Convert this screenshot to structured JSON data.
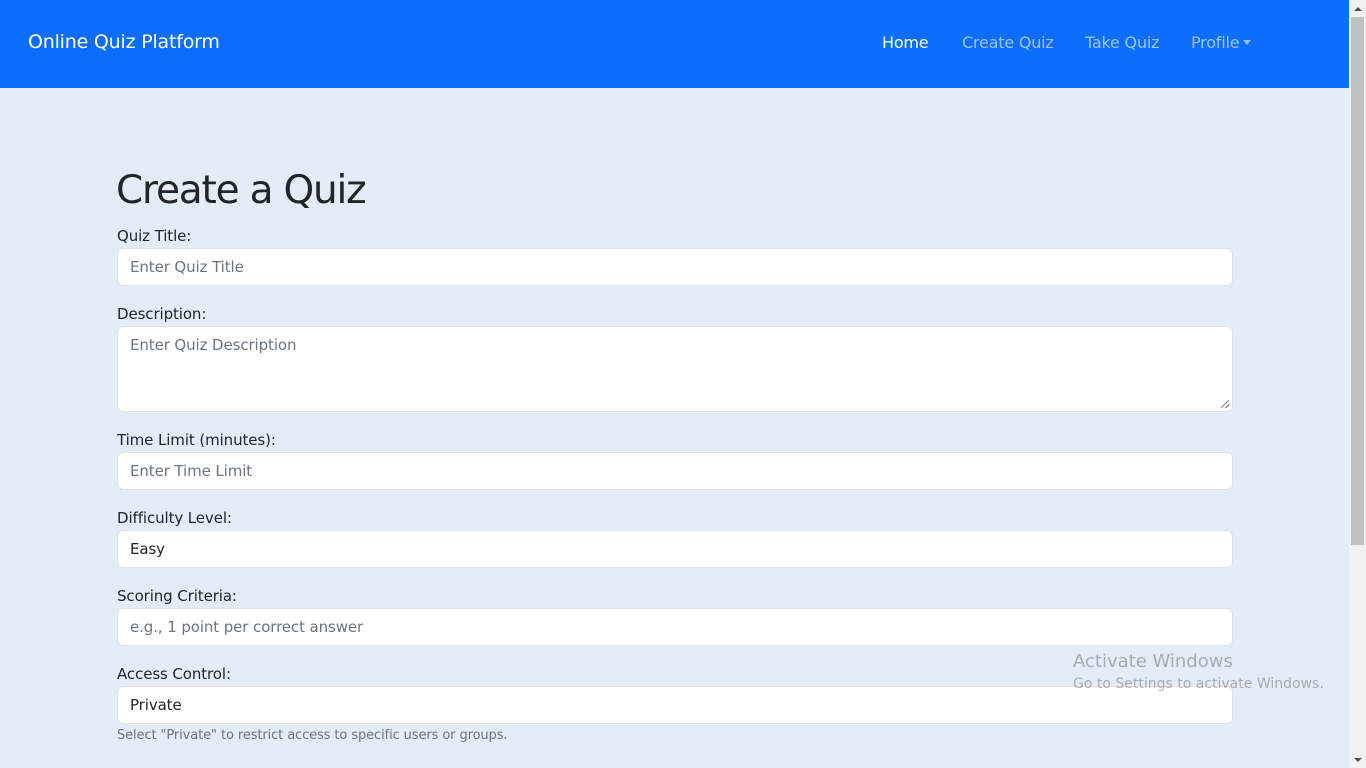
{
  "navbar": {
    "brand": "Online Quiz Platform",
    "links": [
      "Home",
      "Create Quiz",
      "Take Quiz",
      "Profile"
    ],
    "active": "Home"
  },
  "page": {
    "title": "Create a Quiz"
  },
  "form": {
    "quiz_title": {
      "label": "Quiz Title:",
      "placeholder": "Enter Quiz Title"
    },
    "description": {
      "label": "Description:",
      "placeholder": "Enter Quiz Description"
    },
    "time_limit": {
      "label": "Time Limit (minutes):",
      "placeholder": "Enter Time Limit"
    },
    "difficulty": {
      "label": "Difficulty Level:",
      "value": "Easy"
    },
    "scoring": {
      "label": "Scoring Criteria:",
      "placeholder": "e.g., 1 point per correct answer"
    },
    "access": {
      "label": "Access Control:",
      "value": "Private",
      "help": "Select \"Private\" to restrict access to specific users or groups."
    }
  },
  "watermark": {
    "line1": "Activate Windows",
    "line2": "Go to Settings to activate Windows."
  },
  "colors": {
    "navbar": "#0d6efd",
    "background": "#e3ecf7"
  }
}
